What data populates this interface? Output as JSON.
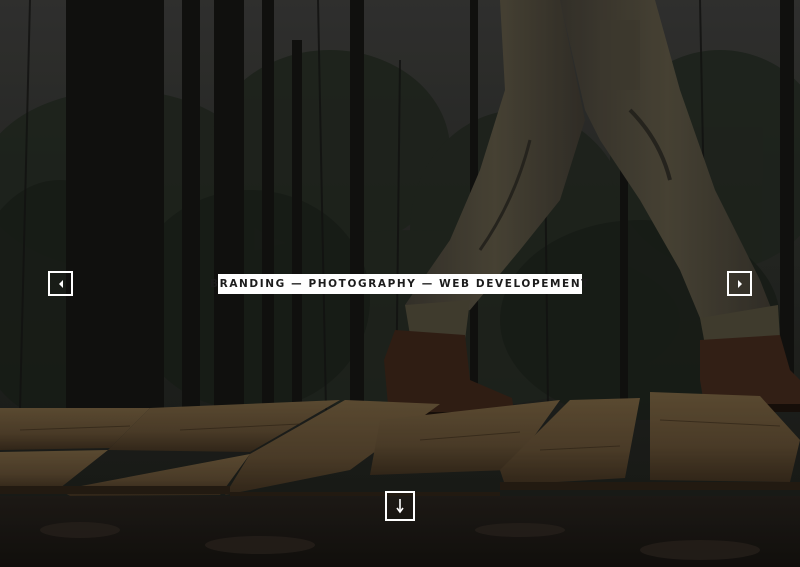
{
  "hero": {
    "tagline": "BRANDING — PHOTOGRAPHY — WEB DEVELOPEMENT",
    "prev_icon": "caret-left-icon",
    "next_icon": "caret-right-icon",
    "scroll_icon": "arrow-down-icon",
    "background": "photo: hiker walking on wooden boardwalk in dark forest"
  },
  "colors": {
    "overlay": "#000000",
    "tagline_bg": "#ffffff",
    "tagline_text": "#1c1c1c",
    "button_border": "#ffffff"
  }
}
